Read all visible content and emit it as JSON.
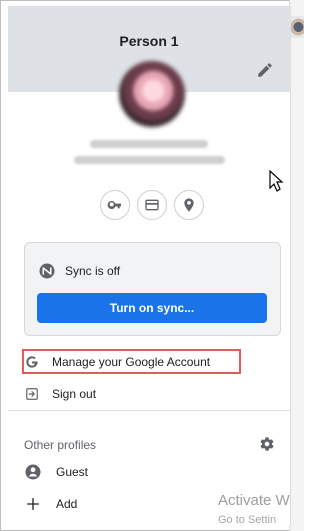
{
  "profile": {
    "title": "Person 1"
  },
  "sync": {
    "status": "Sync is off",
    "button_label": "Turn on sync..."
  },
  "menu": {
    "manage_account": "Manage your Google Account",
    "sign_out": "Sign out"
  },
  "other_profiles": {
    "label": "Other profiles",
    "items": [
      {
        "label": "Guest"
      },
      {
        "label": "Add"
      }
    ]
  },
  "watermark": {
    "line1": "Activate W",
    "line2": "Go to Settin"
  },
  "colors": {
    "accent": "#1a73e8",
    "header_bg": "#dee1e6",
    "highlight": "#e45b5b"
  },
  "icons": {
    "edit": "pencil-icon",
    "key": "key-icon",
    "card": "credit-card-icon",
    "location": "location-pin-icon",
    "sync": "sync-off-icon",
    "google": "google-g-icon",
    "sign_out": "sign-out-icon",
    "gear": "gear-icon",
    "guest": "guest-person-icon",
    "add": "plus-icon"
  }
}
